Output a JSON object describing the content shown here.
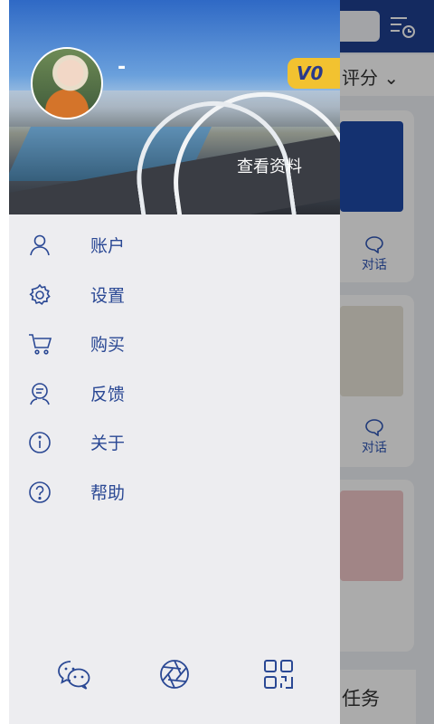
{
  "background_app": {
    "sort_label": "评分",
    "talk_label_1": "对话",
    "talk_label_2": "对话",
    "task_label": "任务"
  },
  "drawer": {
    "username": "-",
    "vip_badge": "V0",
    "view_profile": "查看资料",
    "menu": [
      {
        "label": "账户",
        "icon": "user-icon"
      },
      {
        "label": "设置",
        "icon": "gear-icon"
      },
      {
        "label": "购买",
        "icon": "cart-icon"
      },
      {
        "label": "反馈",
        "icon": "feedback-icon"
      },
      {
        "label": "关于",
        "icon": "info-icon"
      },
      {
        "label": "帮助",
        "icon": "help-icon"
      }
    ],
    "bottom_icons": [
      "wechat-icon",
      "aperture-icon",
      "qr-code-icon"
    ]
  },
  "colors": {
    "primary": "#2a4894",
    "topbar": "#1e3f8f",
    "badge": "#f2c230",
    "drawer_bg": "#ededf0"
  }
}
